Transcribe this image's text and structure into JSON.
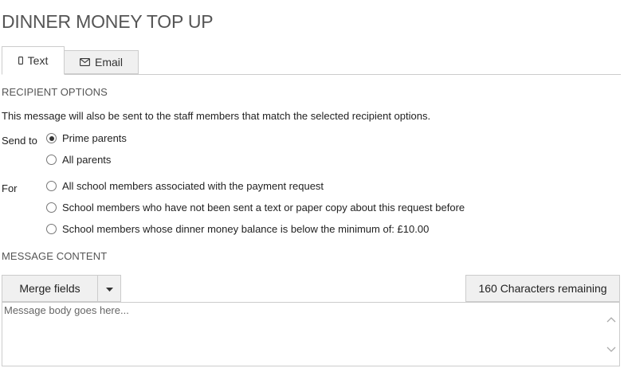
{
  "page": {
    "title": "DINNER MONEY TOP UP"
  },
  "tabs": [
    {
      "label": "Text",
      "icon": "mobile-phone-icon",
      "active": true
    },
    {
      "label": "Email",
      "icon": "envelope-icon",
      "active": false
    }
  ],
  "recipient_options": {
    "heading": "RECIPIENT OPTIONS",
    "info": "This message will also be sent to the staff members that match the selected recipient options.",
    "send_to": {
      "label": "Send to",
      "options": [
        {
          "label": "Prime parents",
          "checked": true
        },
        {
          "label": "All parents",
          "checked": false
        }
      ]
    },
    "for": {
      "label": "For",
      "options": [
        {
          "label": "All school members associated with the payment request",
          "checked": false
        },
        {
          "label": "School members who have not been sent a text or paper copy about this request before",
          "checked": false
        },
        {
          "label": "School members whose dinner money balance is below the minimum of: £10.00",
          "checked": false
        }
      ]
    }
  },
  "message_content": {
    "heading": "MESSAGE CONTENT",
    "merge_fields_label": "Merge fields",
    "chars_remaining": "160 Characters remaining",
    "body_placeholder": "Message body goes here..."
  }
}
